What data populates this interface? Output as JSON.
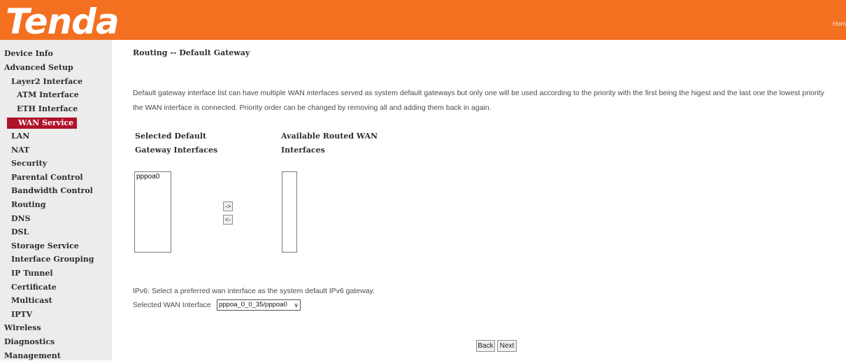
{
  "header": {
    "logo": "Tenda",
    "link": "Hom"
  },
  "sidebar": {
    "items": [
      "Device Info",
      "Advanced Setup",
      "Layer2 Interface",
      "ATM Interface",
      "ETH Interface",
      "WAN Service",
      "LAN",
      "NAT",
      "Security",
      "Parental Control",
      "Bandwidth Control",
      "Routing",
      "DNS",
      "DSL",
      "Storage Service",
      "Interface Grouping",
      "IP Tunnel",
      "Certificate",
      "Multicast",
      "IPTV",
      "Wireless",
      "Diagnostics",
      "Management"
    ],
    "active": "WAN Service"
  },
  "main": {
    "title": "Routing -- Default Gateway",
    "description_line1": "Default gateway interface list can have multiple WAN interfaces served as system default gateways but only one will be used according to the priority with the first being the higest and the last one the lowest priority",
    "description_line2": "the WAN interface is connected. Priority order can be changed by removing all and adding them back in again.",
    "selected_heading_line1": "Selected Default",
    "selected_heading_line2": "Gateway Interfaces",
    "available_heading_line1": "Available Routed WAN",
    "available_heading_line2": "Interfaces",
    "selected_items": [
      "pppoa0"
    ],
    "available_items": [],
    "move_right_label": "->",
    "move_left_label": "<-",
    "ipv6_text": "IPv6: Select a preferred wan interface as the system default IPv6 gateway.",
    "wan_select_label": "Selected WAN Interface",
    "wan_select_value": "pppoa_0_0_35/pppoa0",
    "back_label": "Back",
    "next_label": "Next"
  }
}
